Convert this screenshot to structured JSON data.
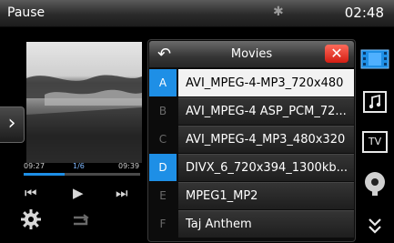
{
  "status": {
    "title": "Pause",
    "clock": "02:48"
  },
  "player": {
    "elapsed": "09:27",
    "track": "1/6",
    "total": "09:39",
    "progress": 0.35
  },
  "panel": {
    "title": "Movies",
    "items": [
      {
        "letter": "A",
        "label": "AVI_MPEG-4-MP3_720x480",
        "active": true,
        "selected": true
      },
      {
        "letter": "B",
        "label": "AVI_MPEG-4 ASP_PCM_72...",
        "active": false,
        "selected": false
      },
      {
        "letter": "C",
        "label": "AVI_MPEG-4_MP3_480x320",
        "active": false,
        "selected": false
      },
      {
        "letter": "D",
        "label": "DIVX_6_720x394_1300kb...",
        "active": true,
        "selected": false
      },
      {
        "letter": "E",
        "label": "MPEG1_MP2",
        "active": false,
        "selected": false
      },
      {
        "letter": "F",
        "label": "Taj Anthem",
        "active": false,
        "selected": false
      }
    ]
  },
  "rightbar": {
    "tv_label": "TV"
  },
  "colors": {
    "accent": "#1e8fe6",
    "close": "#e0261a"
  }
}
